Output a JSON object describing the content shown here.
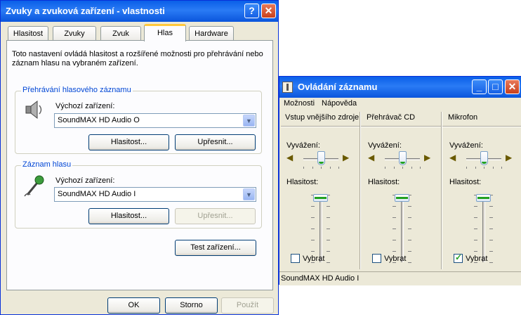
{
  "sound_props": {
    "title": "Zvuky a zvuková zařízení - vlastnosti",
    "tabs": [
      "Hlasitost",
      "Zvuky",
      "Zvuk",
      "Hlas",
      "Hardware"
    ],
    "active_tab": "Hlas",
    "description": "Toto nastavení ovládá hlasitost a rozšířené možnosti pro přehrávání nebo záznam hlasu na vybraném zařízení.",
    "playback": {
      "group_title": "Přehrávání hlasového záznamu",
      "device_label": "Výchozí zařízení:",
      "device_value": "SoundMAX HD Audio O",
      "volume_button": "Hlasitost...",
      "advanced_button": "Upřesnit..."
    },
    "recording": {
      "group_title": "Záznam hlasu",
      "device_label": "Výchozí zařízení:",
      "device_value": "SoundMAX HD Audio I",
      "volume_button": "Hlasitost...",
      "advanced_button": "Upřesnit..."
    },
    "test_button": "Test zařízení...",
    "ok_button": "OK",
    "cancel_button": "Storno",
    "apply_button": "Použít"
  },
  "recording_control": {
    "title": "Ovládání záznamu",
    "menu": [
      "Možnosti",
      "Nápověda"
    ],
    "balance_label": "Vyvážení:",
    "volume_label": "Hlasitost:",
    "select_label": "Vybrat",
    "columns": [
      {
        "name": "Vstup vnějšího zdroje",
        "volume": 0.95,
        "balance": 0.5,
        "selected": false
      },
      {
        "name": "Přehrávač CD",
        "volume": 0.95,
        "balance": 0.5,
        "selected": false
      },
      {
        "name": "Mikrofon",
        "volume": 0.95,
        "balance": 0.5,
        "selected": true
      }
    ],
    "status": "SoundMAX HD Audio I"
  }
}
